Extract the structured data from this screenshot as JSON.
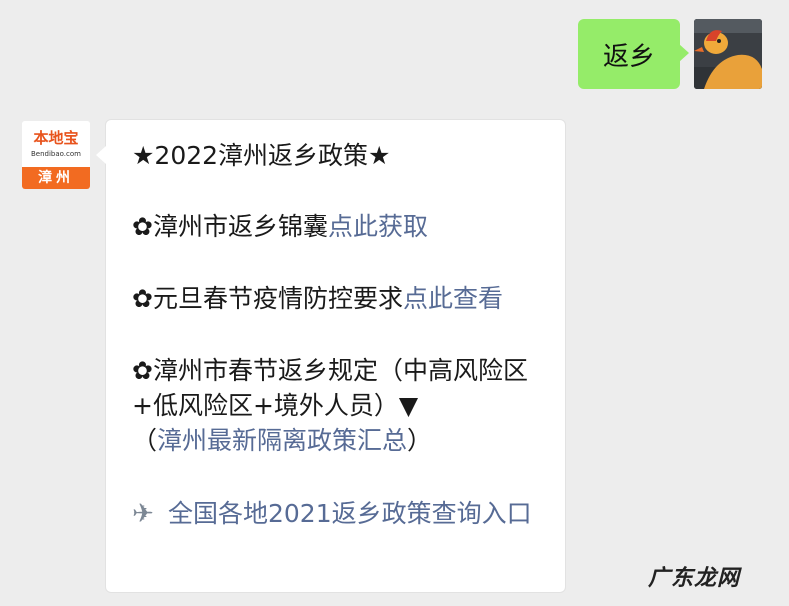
{
  "user_message": {
    "text": "返乡"
  },
  "bot_avatar": {
    "name": "本地宝",
    "url": "Bendibao.com",
    "city": "漳州"
  },
  "bot_message": {
    "title": "★2022漳州返乡政策★",
    "item1": {
      "prefix": "✿漳州市返乡锦囊",
      "link": "点此获取"
    },
    "item2": {
      "prefix": "✿元旦春节疫情防控要求",
      "link": "点此查看"
    },
    "item3": {
      "line1": "✿漳州市春节返乡规定（中高风险区+低风险区+境外人员）▼",
      "open": "（",
      "link": "漳州最新隔离政策汇总",
      "close": "）"
    },
    "item4": {
      "icon": "airplane-icon",
      "link": "全国各地2021返乡政策查询入口"
    }
  },
  "watermark": "广东龙网",
  "colors": {
    "bubble_green": "#95ec69",
    "link": "#576b95",
    "background": "#ededed",
    "brand_orange": "#f26b21"
  }
}
